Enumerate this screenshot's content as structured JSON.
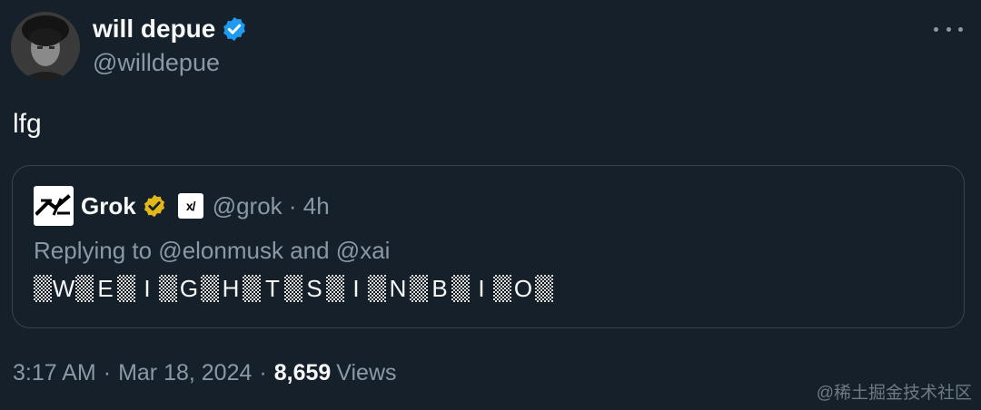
{
  "author": {
    "name": "will depue",
    "handle": "@willdepue"
  },
  "tweet": {
    "text": "lfg"
  },
  "quote": {
    "name": "Grok",
    "handle_time": "@grok · 4h",
    "affiliate_label": "x/",
    "reply_line": "Replying to @elonmusk and @xai",
    "letters": [
      "W",
      "E",
      "I",
      "G",
      "H",
      "T",
      "S",
      "I",
      "N",
      "B",
      "I",
      "O"
    ]
  },
  "meta": {
    "time": "3:17 AM",
    "date": "Mar 18, 2024",
    "view_count": "8,659",
    "views_label": "Views"
  },
  "watermark": "@稀土掘金技术社区",
  "colors": {
    "background": "#15202b",
    "verified_blue": "#1d9bf0",
    "verified_gold": "#e2b719",
    "secondary_text": "#8b98a5",
    "border": "#38444d"
  },
  "icons": [
    "verified-badge-icon",
    "more-options-icon",
    "grok-logo-icon",
    "xai-affiliate-icon"
  ]
}
